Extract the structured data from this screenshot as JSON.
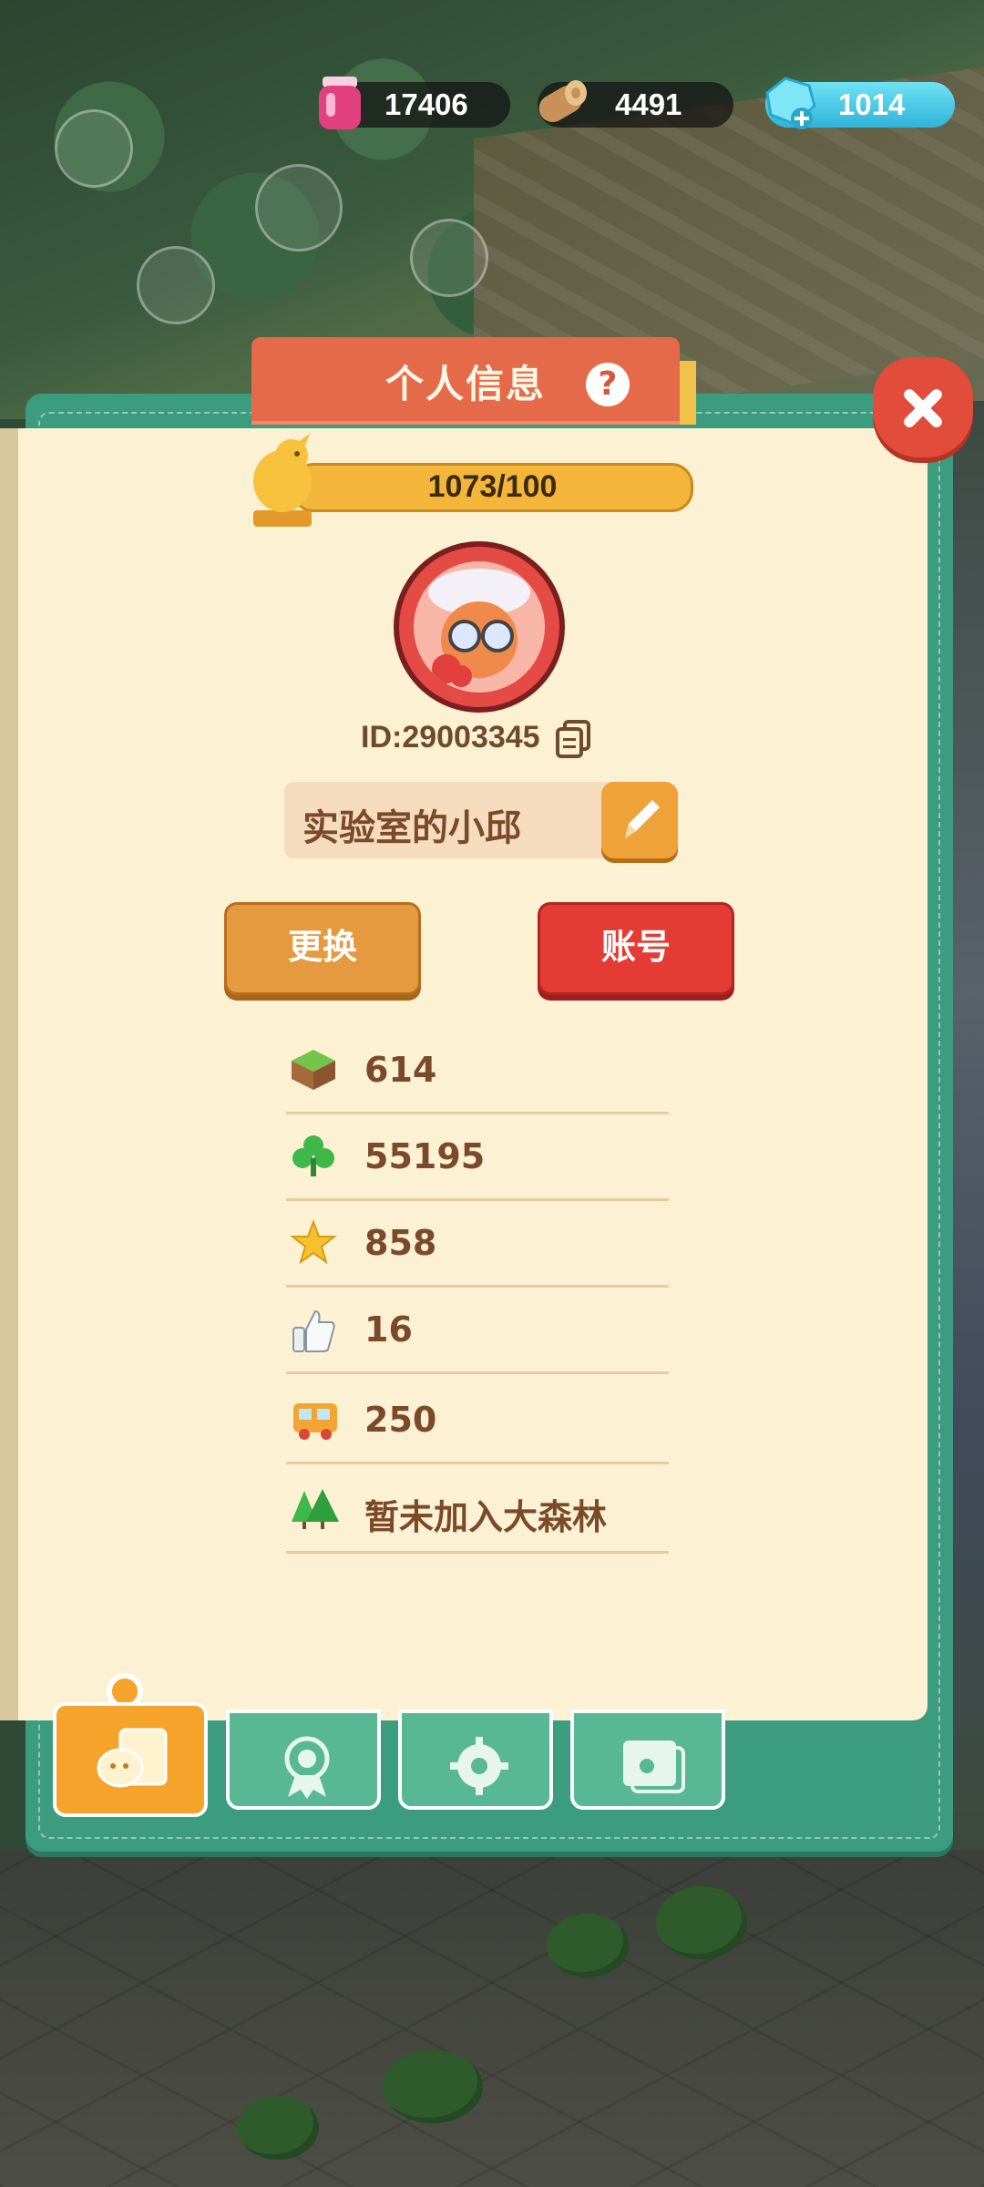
{
  "resources": {
    "jam": {
      "value": "17406",
      "icon": "jam-jar-icon"
    },
    "wood": {
      "value": "4491",
      "icon": "wood-log-icon"
    },
    "gem": {
      "value": "1014",
      "icon": "gem-icon"
    }
  },
  "panel": {
    "title": "个人信息",
    "help_label": "?",
    "close_icon": "close-icon"
  },
  "profile": {
    "level_progress": "1073/100",
    "id_label": "ID:29003345",
    "name": "实验室的小邱"
  },
  "buttons": {
    "change": "更换",
    "account": "账号"
  },
  "stats": [
    {
      "icon": "land-block-icon",
      "value": "614"
    },
    {
      "icon": "clover-icon",
      "value": "55195"
    },
    {
      "icon": "star-icon",
      "value": "858"
    },
    {
      "icon": "thumbs-up-icon",
      "value": "16"
    },
    {
      "icon": "bus-icon",
      "value": "250"
    },
    {
      "icon": "forest-icon",
      "value": "暂未加入大森林"
    }
  ],
  "tabs": [
    {
      "name": "profile-tab",
      "icon": "profile-card-icon",
      "active": true
    },
    {
      "name": "badge-tab",
      "icon": "badge-icon",
      "active": false
    },
    {
      "name": "settings-tab",
      "icon": "gear-icon",
      "active": false
    },
    {
      "name": "album-tab",
      "icon": "album-icon",
      "active": false
    }
  ],
  "colors": {
    "panel_frame": "#3c9c7f",
    "page": "#fdf1d4",
    "title_tab": "#e56a49",
    "accent_orange": "#f5a32a",
    "account_red": "#e43b34",
    "text_brown": "#7a4a2a"
  }
}
